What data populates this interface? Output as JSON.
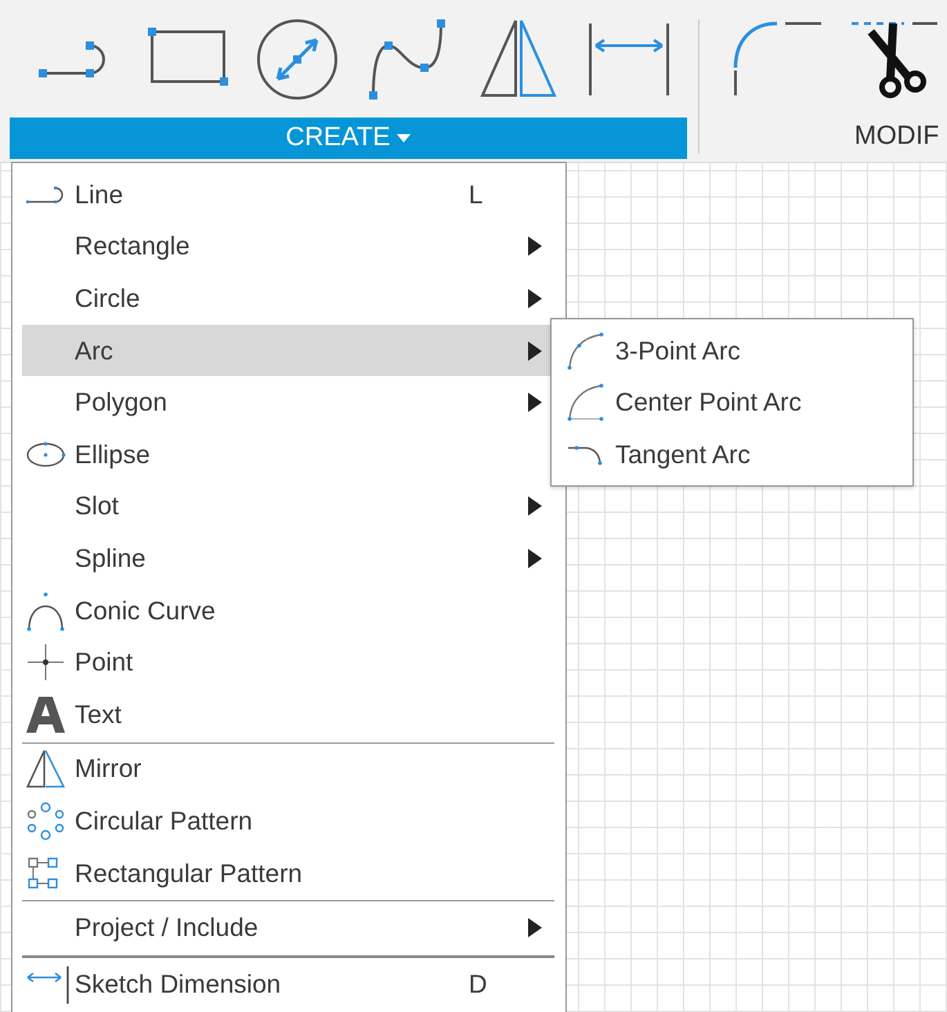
{
  "toolbar": {
    "create_button": {
      "label": "CREATE"
    },
    "modify_label": "MODIF"
  },
  "create_menu": {
    "groups": [
      [
        {
          "label": "Line",
          "shortcut": "L",
          "submenu": false,
          "selected": false
        },
        {
          "label": "Rectangle",
          "submenu": true,
          "selected": false
        },
        {
          "label": "Circle",
          "submenu": true,
          "selected": false
        },
        {
          "label": "Arc",
          "submenu": true,
          "selected": true
        },
        {
          "label": "Polygon",
          "submenu": true,
          "selected": false
        },
        {
          "label": "Ellipse",
          "submenu": false,
          "selected": false
        },
        {
          "label": "Slot",
          "submenu": true,
          "selected": false
        },
        {
          "label": "Spline",
          "submenu": true,
          "selected": false
        },
        {
          "label": "Conic Curve",
          "submenu": false,
          "selected": false
        },
        {
          "label": "Point",
          "submenu": false,
          "selected": false
        },
        {
          "label": "Text",
          "submenu": false,
          "selected": false
        }
      ],
      [
        {
          "label": "Mirror",
          "submenu": false,
          "selected": false
        },
        {
          "label": "Circular Pattern",
          "submenu": false,
          "selected": false
        },
        {
          "label": "Rectangular Pattern",
          "submenu": false,
          "selected": false
        }
      ],
      [
        {
          "label": "Project / Include",
          "submenu": true,
          "selected": false
        }
      ],
      [
        {
          "label": "Sketch Dimension",
          "shortcut": "D",
          "submenu": false,
          "selected": false
        }
      ]
    ]
  },
  "arc_submenu": {
    "items": [
      {
        "label": "3-Point Arc",
        "selected": false
      },
      {
        "label": "Center Point Arc",
        "selected": false
      },
      {
        "label": "Tangent Arc",
        "selected": false
      }
    ]
  }
}
